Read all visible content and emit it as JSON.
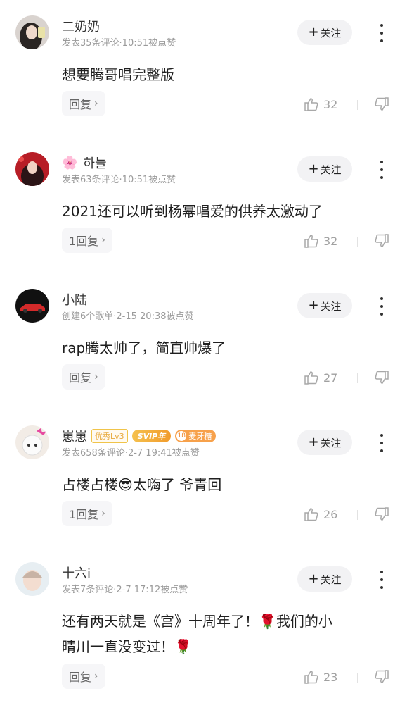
{
  "follow_label": "关注",
  "comments": [
    {
      "username": "二奶奶",
      "meta": "发表35条评论·10:51被点赞",
      "content": "想要腾哥唱完整版",
      "reply_label": "回复",
      "likes": "32"
    },
    {
      "username": "하늘",
      "username_emoji": "🌸",
      "meta": "发表63条评论·10:51被点赞",
      "content": "2021还可以听到杨幂唱爱的供养太激动了",
      "reply_label": "1回复",
      "likes": "32"
    },
    {
      "username": "小陆",
      "meta": "创建6个歌单·2-15 20:38被点赞",
      "content": "rap腾太帅了，简直帅爆了",
      "reply_label": "回复",
      "likes": "27"
    },
    {
      "username": "崽崽",
      "badges": {
        "excellent": "优秀Lv3",
        "svip": "SVIP年",
        "level": "18",
        "group": "麦牙糖"
      },
      "meta": "发表658条评论·2-7 19:41被点赞",
      "content_before": "占楼占楼",
      "content_emoji": "😎",
      "content_after": "太嗨了 爷青回",
      "reply_label": "1回复",
      "likes": "26"
    },
    {
      "username": "十六i",
      "meta": "发表7条评论·2-7 17:12被点赞",
      "content_line1_a": "还有两天就是《宫》十周年了！",
      "content_rose1": "🌹",
      "content_line1_b": "我们的小",
      "content_line2_a": "晴川一直没变过！",
      "content_rose2": "🌹",
      "reply_label": "回复",
      "likes": "23"
    }
  ]
}
